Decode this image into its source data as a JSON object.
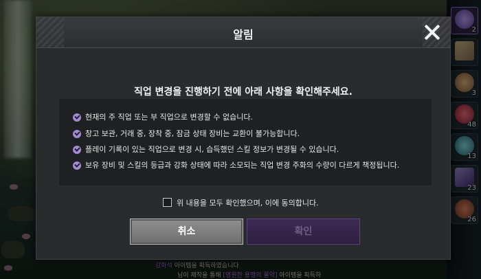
{
  "modal": {
    "title": "알림",
    "prompt": "직업 변경을 진행하기 전에 아래 사항을 확인해주세요.",
    "notices": [
      "현재의 주 직업 또는 부 직업으로 변경할 수 없습니다.",
      "창고 보관, 거래 중, 장착 중, 잠금 상태 장비는 교환이 불가능합니다.",
      "플레이 기록이 있는 직업으로 변경 시, 습득했던 스킬 정보가 변경될 수 있습니다.",
      "보유 장비 및 스킬의 등급과 강화 상태에 따라 소모되는 직업 변경 주화의 수량이 다르게 책정됩니다."
    ],
    "agree_label": "위 내용을 모두 확인했으며, 이에 동의합니다.",
    "agree_checked": false,
    "cancel_label": "취소",
    "confirm_label": "확인",
    "confirm_enabled": false
  },
  "side_bar": {
    "slots": [
      {
        "icon": "purple-coin-icon",
        "qty": "2"
      },
      {
        "icon": "no-trade-scroll-icon",
        "qty": ""
      },
      {
        "icon": "potion-jar-icon",
        "qty": "3"
      },
      {
        "icon": "red-potion-icon",
        "qty": "48"
      },
      {
        "icon": "teal-flask-icon",
        "qty": "13"
      },
      {
        "icon": "purple-crystal-icon",
        "qty": "23"
      },
      {
        "icon": "food-plate-icon",
        "qty": "26"
      }
    ]
  },
  "chat": {
    "line1_item": "강화석",
    "line1_rest": " 아이템을 획득하였습니다",
    "line2_prefix": "님이 제작을 통해 ",
    "line2_item": "[영원한 용맹의 물약]",
    "line2_rest": " 아이템을 획득하"
  },
  "colors": {
    "accent": "#a58ad6",
    "confirm_disabled_bg": "#3d2a55",
    "cancel_bg": "#7e7e7e",
    "modal_bg": "#2a2b2d"
  }
}
